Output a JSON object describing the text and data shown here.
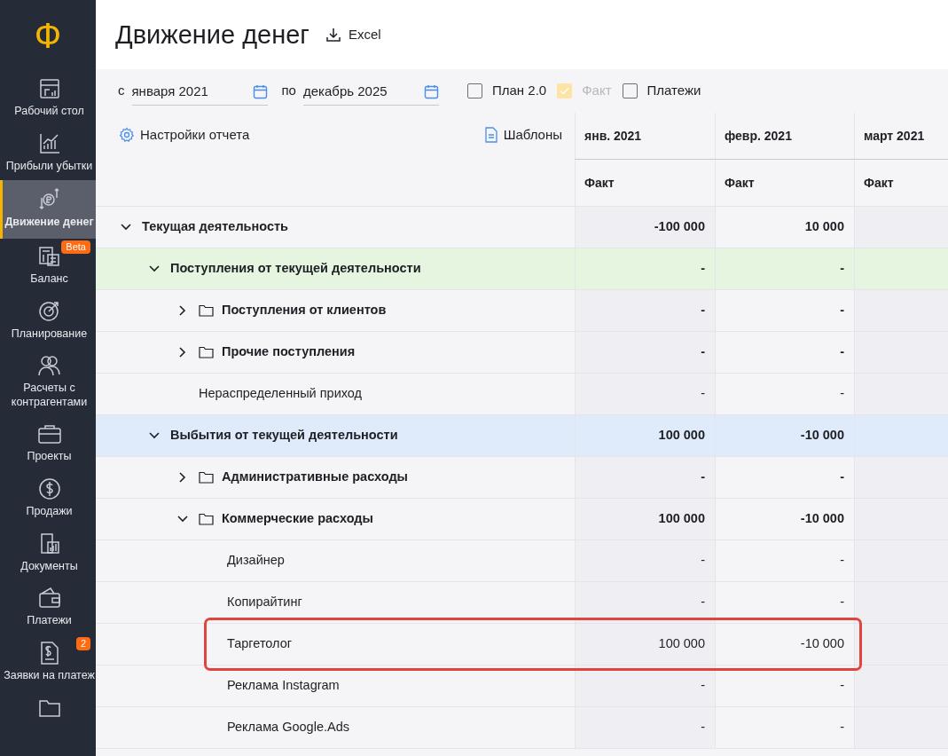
{
  "sidebar": {
    "logo": "Ф",
    "items": [
      {
        "label": "Рабочий стол",
        "selected": false
      },
      {
        "label": "Прибыли убытки",
        "selected": false
      },
      {
        "label": "Движение денег",
        "selected": true
      },
      {
        "label": "Баланс",
        "selected": false,
        "badge": "Beta"
      },
      {
        "label": "Планирование",
        "selected": false
      },
      {
        "label": "Расчеты с контрагентами",
        "selected": false
      },
      {
        "label": "Проекты",
        "selected": false
      },
      {
        "label": "Продажи",
        "selected": false
      },
      {
        "label": "Документы",
        "selected": false
      },
      {
        "label": "Платежи",
        "selected": false
      },
      {
        "label": "Заявки на платеж",
        "selected": false,
        "badge": "2"
      },
      {
        "selected": false
      }
    ]
  },
  "header": {
    "title": "Движение денег",
    "export_button": "Excel"
  },
  "filters": {
    "from_label": "с",
    "from_value": "января 2021",
    "to_label": "по",
    "to_value": "декабрь 2025",
    "checkboxes": [
      {
        "label": "План 2.0",
        "checked": false,
        "disabled": false
      },
      {
        "label": "Факт",
        "checked": true,
        "disabled": true
      },
      {
        "label": "Платежи",
        "checked": false,
        "disabled": false
      }
    ]
  },
  "table": {
    "settings_link": "Настройки отчета",
    "templates_link": "Шаблоны",
    "columns": [
      {
        "month": "янв. 2021",
        "sub": "Факт"
      },
      {
        "month": "февр. 2021",
        "sub": "Факт"
      },
      {
        "month": "март 2021",
        "sub": "Факт"
      }
    ],
    "rows": [
      {
        "kind": "group",
        "label": "Текущая деятельность",
        "expanded": true,
        "values": [
          "-100 000",
          "10 000"
        ],
        "children": [
          {
            "kind": "section",
            "label": "Поступления от текущей деятельности",
            "expanded": true,
            "color": "#e5f5df",
            "values": [
              "-",
              "-"
            ],
            "children": [
              {
                "kind": "folder",
                "label": "Поступления от клиентов",
                "expanded": false,
                "values": [
                  "-",
                  "-"
                ]
              },
              {
                "kind": "folder",
                "label": "Прочие поступления",
                "expanded": false,
                "values": [
                  "-",
                  "-"
                ]
              },
              {
                "kind": "item",
                "label": "Нераспределенный приход",
                "values": [
                  "-",
                  "-"
                ]
              }
            ]
          },
          {
            "kind": "section",
            "label": "Выбытия от текущей деятельности",
            "expanded": true,
            "color": "#dfeafb",
            "values": [
              "100 000",
              "-10 000"
            ],
            "children": [
              {
                "kind": "folder",
                "label": "Административные расходы",
                "expanded": false,
                "values": [
                  "-",
                  "-"
                ]
              },
              {
                "kind": "folder",
                "label": "Коммерческие расходы",
                "expanded": true,
                "values": [
                  "100 000",
                  "-10 000"
                ],
                "children": [
                  {
                    "kind": "item",
                    "label": "Дизайнер",
                    "highlighted": false,
                    "values": [
                      "-",
                      "-"
                    ]
                  },
                  {
                    "kind": "item",
                    "label": "Копирайтинг",
                    "highlighted": false,
                    "values": [
                      "-",
                      "-"
                    ]
                  },
                  {
                    "kind": "item",
                    "label": "Таргетолог",
                    "highlighted": true,
                    "values": [
                      "100 000",
                      "-10 000"
                    ]
                  },
                  {
                    "kind": "item",
                    "label": "Реклама Instagram",
                    "highlighted": false,
                    "values": [
                      "-",
                      "-"
                    ]
                  },
                  {
                    "kind": "item",
                    "label": "Реклама Google.Ads",
                    "highlighted": false,
                    "values": [
                      "-",
                      "-"
                    ]
                  }
                ]
              }
            ]
          }
        ]
      }
    ]
  }
}
